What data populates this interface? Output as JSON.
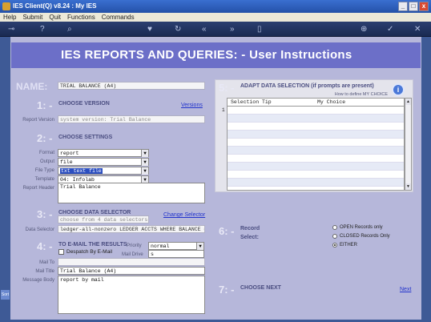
{
  "window": {
    "title": "IES Client(Q) v8.24 : My IES",
    "buttons": [
      "_",
      "□",
      "x"
    ]
  },
  "menu": [
    "Help",
    "Submit",
    "Quit",
    "Functions",
    "Commands"
  ],
  "toolbar_icons": [
    "key-icon",
    "help-icon",
    "search-icon",
    "heart-icon",
    "refresh-icon",
    "rewind-icon",
    "forward-icon",
    "bookmark-icon",
    "add-icon",
    "check-icon",
    "close-icon"
  ],
  "header": {
    "title": "IES REPORTS AND QUERIES: -   User Instructions"
  },
  "side_tab": "Sort",
  "name": {
    "label": "NAME:",
    "value": "TRIAL BALANCE (A4)"
  },
  "s1": {
    "num": "1: -",
    "title": "CHOOSE VERSION",
    "link": "Versions",
    "report_version_label": "Report Version",
    "report_version": "system version: Trial Balance"
  },
  "s2": {
    "num": "2: -",
    "title": "CHOOSE SETTINGS",
    "format_label": "Format",
    "format": "report",
    "output_label": "Output",
    "output": "file",
    "filetype_label": "File Type",
    "filetype": "txt text file",
    "template_label": "Template",
    "template": "04: Infolab",
    "header_label": "Report Header",
    "header": "Trial Balance"
  },
  "s3": {
    "num": "3: -",
    "title": "CHOOSE DATA SELECTOR",
    "link": "Change Selector",
    "hint": "choose from 4 data selectors",
    "selector_label": "Data Selector",
    "selector": "ledger-all-nonzero LEDGER ACCTS WHERE BALANCE # 0"
  },
  "s4": {
    "num": "4: -",
    "title": "TO E-MAIL THE RESULTS",
    "despatch": "Despatch By E-Mail",
    "priority_label": "Priority",
    "priority": "normal",
    "maildrive_label": "Mail Drive",
    "maildrive": "s",
    "mailto_label": "Mail To",
    "mailtitle_label": "Mail Title",
    "mailtitle": "Trial Balance (A4)",
    "body_label": "Message Body",
    "body": "report by mail"
  },
  "s5": {
    "num": "5: -",
    "title": "ADAPT DATA SELECTION (if prompts are present)",
    "hint": "How to define MY CHOICE",
    "col1": "Selection Tip",
    "col2": "My Choice",
    "first_row": "1"
  },
  "s6": {
    "num": "6: -",
    "title1": "Record",
    "title2": "Select:",
    "options": [
      "OPEN Records only",
      "CLOSED Records Only",
      "EITHER"
    ],
    "selected": 2
  },
  "s7": {
    "num": "7: -",
    "title": "CHOOSE NEXT",
    "link": "Next"
  }
}
